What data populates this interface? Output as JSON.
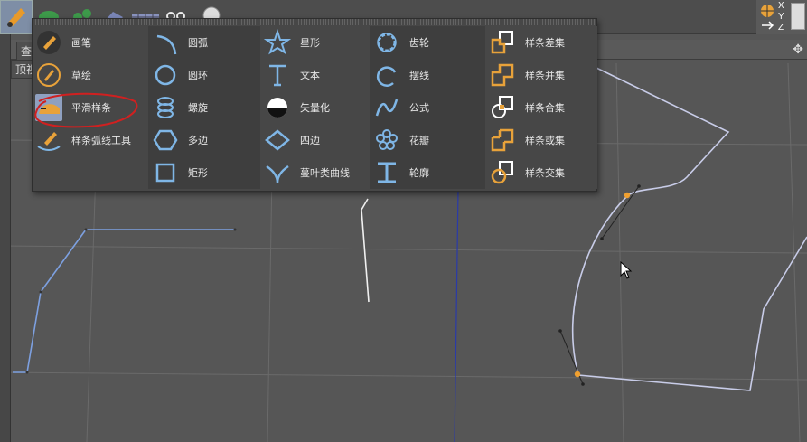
{
  "viewport": {
    "view_tabs": [
      "查看",
      "顶视"
    ]
  },
  "axis_widget": {
    "label_x": "X",
    "label_y": "Y",
    "label_z": "Z"
  },
  "menu": {
    "columns": [
      {
        "items": [
          {
            "label": "画笔",
            "icon": "pen-icon"
          },
          {
            "label": "草绘",
            "icon": "sketch-icon"
          },
          {
            "label": "平滑样条",
            "icon": "smooth-spline-icon",
            "highlighted": true
          },
          {
            "label": "样条弧线工具",
            "icon": "spline-arc-tool-icon"
          }
        ]
      },
      {
        "items": [
          {
            "label": "圆弧",
            "icon": "arc-icon"
          },
          {
            "label": "圆环",
            "icon": "circle-icon"
          },
          {
            "label": "螺旋",
            "icon": "helix-icon"
          },
          {
            "label": "多边",
            "icon": "polygon-icon"
          },
          {
            "label": "矩形",
            "icon": "rectangle-icon"
          }
        ]
      },
      {
        "items": [
          {
            "label": "星形",
            "icon": "star-icon"
          },
          {
            "label": "文本",
            "icon": "text-icon"
          },
          {
            "label": "矢量化",
            "icon": "vectorizer-icon"
          },
          {
            "label": "四边",
            "icon": "four-side-icon"
          },
          {
            "label": "蔓叶类曲线",
            "icon": "cissoid-icon"
          }
        ]
      },
      {
        "items": [
          {
            "label": "齿轮",
            "icon": "gear-icon"
          },
          {
            "label": "摆线",
            "icon": "cycloid-icon"
          },
          {
            "label": "公式",
            "icon": "formula-icon"
          },
          {
            "label": "花瓣",
            "icon": "flower-icon"
          },
          {
            "label": "轮廓",
            "icon": "profile-icon"
          }
        ]
      },
      {
        "items": [
          {
            "label": "样条差集",
            "icon": "spline-subtract-icon"
          },
          {
            "label": "样条并集",
            "icon": "spline-union-icon"
          },
          {
            "label": "样条合集",
            "icon": "spline-and-icon"
          },
          {
            "label": "样条或集",
            "icon": "spline-or-icon"
          },
          {
            "label": "样条交集",
            "icon": "spline-intersect-icon"
          }
        ]
      }
    ]
  },
  "colors": {
    "icon_blue": "#7fb6e6",
    "icon_orange": "#e8a23a",
    "spline_blue": "#7da0e0",
    "spline_white": "#e8e8f0",
    "grid": "#666666",
    "annotation_red": "#d02020"
  }
}
